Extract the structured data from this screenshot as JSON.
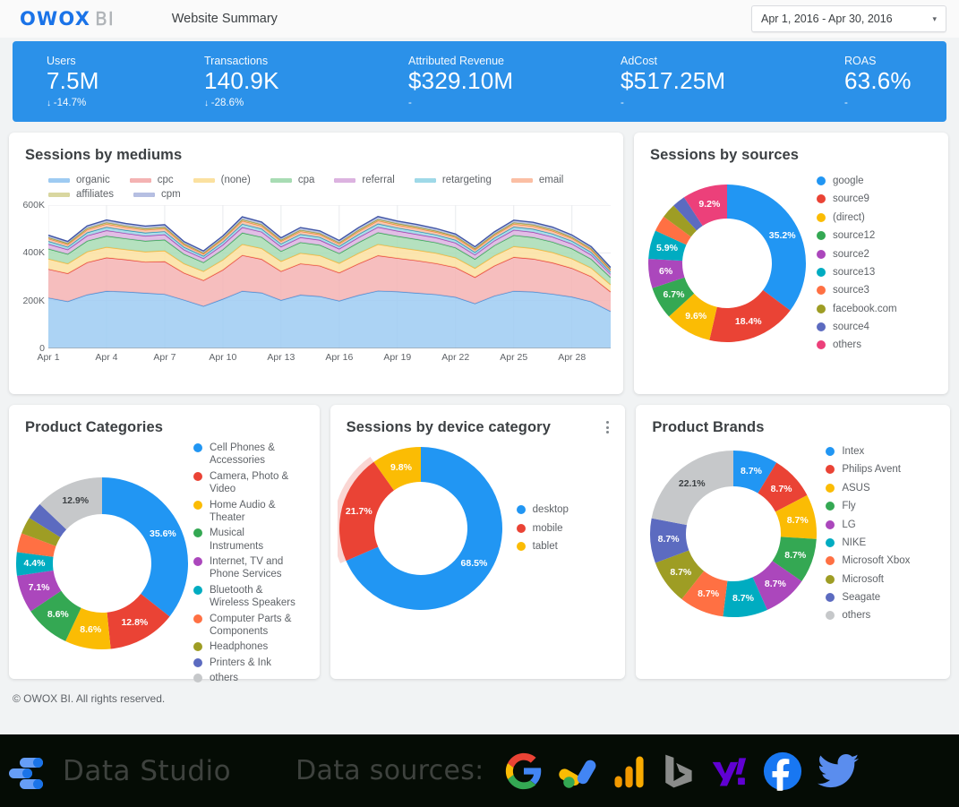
{
  "header": {
    "logo_primary": "OWOX",
    "logo_secondary": "BI",
    "report_title": "Website Summary",
    "date_range": "Apr 1, 2016 - Apr 30, 2016",
    "caret": "▾"
  },
  "scorecards": [
    {
      "label": "Users",
      "value": "7.5M",
      "delta": "-14.7%",
      "arrow": "↓"
    },
    {
      "label": "Transactions",
      "value": "140.9K",
      "delta": "-28.6%",
      "arrow": "↓"
    },
    {
      "label": "Attributed Revenue",
      "value": "$329.10M",
      "delta": "-",
      "arrow": ""
    },
    {
      "label": "AdCost",
      "value": "$517.25M",
      "delta": "-",
      "arrow": ""
    },
    {
      "label": "ROAS",
      "value": "63.6%",
      "delta": "-",
      "arrow": ""
    }
  ],
  "cards": {
    "mediums": {
      "title": "Sessions by mediums"
    },
    "sources": {
      "title": "Sessions by sources"
    },
    "categories": {
      "title": "Product Categories"
    },
    "devices": {
      "title": "Sessions by device category",
      "menu_icon": "kebab-menu-icon"
    },
    "brands": {
      "title": "Product Brands"
    }
  },
  "footer": {
    "copyright": "© OWOX BI. All rights reserved.",
    "data_studio_brand": "Data Studio",
    "data_sources_label": "Data sources:",
    "source_icons": [
      "google-icon",
      "google-ads-icon",
      "google-analytics-icon",
      "bing-icon",
      "yahoo-icon",
      "facebook-icon",
      "twitter-icon"
    ]
  },
  "chart_data": [
    {
      "id": "mediums",
      "type": "area",
      "title": "Sessions by mediums",
      "stacked": true,
      "xlabel": "",
      "ylabel": "",
      "ylim": [
        0,
        600000
      ],
      "yticks": [
        "0",
        "200K",
        "400K",
        "600K"
      ],
      "ytick_values": [
        0,
        200000,
        400000,
        600000
      ],
      "grid": true,
      "legend_position": "top",
      "x": [
        "Apr 1",
        "Apr 2",
        "Apr 3",
        "Apr 4",
        "Apr 5",
        "Apr 6",
        "Apr 7",
        "Apr 8",
        "Apr 9",
        "Apr 10",
        "Apr 11",
        "Apr 12",
        "Apr 13",
        "Apr 14",
        "Apr 15",
        "Apr 16",
        "Apr 17",
        "Apr 18",
        "Apr 19",
        "Apr 20",
        "Apr 21",
        "Apr 22",
        "Apr 23",
        "Apr 24",
        "Apr 25",
        "Apr 26",
        "Apr 27",
        "Apr 28",
        "Apr 29",
        "Apr 30"
      ],
      "xticks": [
        "Apr 1",
        "Apr 4",
        "Apr 7",
        "Apr 10",
        "Apr 13",
        "Apr 16",
        "Apr 19",
        "Apr 22",
        "Apr 25",
        "Apr 28"
      ],
      "series": [
        {
          "name": "organic",
          "color": "#9ecbf2",
          "line": "#4a90d9",
          "values": [
            212000,
            197000,
            225000,
            240000,
            237000,
            232000,
            227000,
            203000,
            177000,
            207000,
            240000,
            233000,
            202000,
            224000,
            218000,
            199000,
            223000,
            241000,
            238000,
            232000,
            226000,
            215000,
            188000,
            220000,
            240000,
            237000,
            228000,
            216000,
            196000,
            155000
          ]
        },
        {
          "name": "cpc",
          "color": "#f4b3b3",
          "line": "#e8453c",
          "values": [
            120000,
            117000,
            135000,
            140000,
            135000,
            130000,
            137000,
            113000,
            108000,
            122000,
            150000,
            141000,
            121000,
            131000,
            128000,
            118000,
            132000,
            148000,
            140000,
            136000,
            130000,
            124000,
            110000,
            126000,
            142000,
            138000,
            131000,
            120000,
            105000,
            82000
          ]
        },
        {
          "name": "(none)",
          "color": "#fbe1a0",
          "line": "#f9b63a",
          "values": [
            43000,
            41000,
            45000,
            44000,
            42000,
            43000,
            45000,
            39000,
            38000,
            42000,
            46000,
            45000,
            42000,
            44000,
            43000,
            40000,
            44000,
            47000,
            45000,
            44000,
            43000,
            41000,
            38000,
            42000,
            45000,
            44000,
            43000,
            40000,
            36000,
            30000
          ]
        },
        {
          "name": "cpa",
          "color": "#a8dcb4",
          "line": "#34a853",
          "values": [
            42000,
            40000,
            45000,
            47000,
            46000,
            45000,
            46000,
            40000,
            37000,
            43000,
            48000,
            47000,
            42000,
            45000,
            44000,
            41000,
            45000,
            49000,
            47000,
            45000,
            44000,
            42000,
            38000,
            43000,
            47000,
            46000,
            44000,
            42000,
            37000,
            30000
          ]
        },
        {
          "name": "referral",
          "color": "#dcb3e0",
          "line": "#a73fb0",
          "values": [
            20000,
            19000,
            22000,
            23000,
            22000,
            21000,
            22000,
            18000,
            17000,
            20000,
            23000,
            22000,
            19000,
            21000,
            21000,
            19000,
            21000,
            23000,
            22000,
            21000,
            21000,
            20000,
            18000,
            20000,
            22000,
            22000,
            21000,
            20000,
            18000,
            14000
          ]
        },
        {
          "name": "retargeting",
          "color": "#9fd9e8",
          "line": "#2196bb",
          "values": [
            12000,
            11000,
            13000,
            14000,
            13000,
            13000,
            13000,
            11000,
            10000,
            12000,
            14000,
            13000,
            12000,
            13000,
            12000,
            11000,
            13000,
            14000,
            13000,
            13000,
            12000,
            12000,
            11000,
            12000,
            13000,
            13000,
            13000,
            12000,
            11000,
            9000
          ]
        },
        {
          "name": "email",
          "color": "#fbbfa4",
          "line": "#f4813c",
          "values": [
            11000,
            10000,
            12000,
            13000,
            12000,
            12000,
            12000,
            10000,
            9000,
            11000,
            13000,
            12000,
            11000,
            12000,
            11000,
            10000,
            12000,
            13000,
            12000,
            12000,
            11000,
            11000,
            10000,
            11000,
            12000,
            12000,
            12000,
            11000,
            10000,
            8000
          ]
        },
        {
          "name": "affiliates",
          "color": "#d9d7a0",
          "line": "#9c9a30",
          "values": [
            5000,
            5000,
            6000,
            6000,
            6000,
            6000,
            6000,
            5000,
            4000,
            5000,
            6000,
            6000,
            5000,
            6000,
            5000,
            5000,
            6000,
            6000,
            6000,
            6000,
            5000,
            5000,
            5000,
            5000,
            6000,
            6000,
            6000,
            5000,
            5000,
            4000
          ]
        },
        {
          "name": "cpm",
          "color": "#b6bfe2",
          "line": "#4156a6",
          "values": [
            9000,
            8000,
            10000,
            11000,
            10000,
            10000,
            10000,
            8000,
            8000,
            9000,
            11000,
            10000,
            9000,
            10000,
            10000,
            9000,
            10000,
            11000,
            10000,
            10000,
            10000,
            9000,
            8000,
            9000,
            10000,
            10000,
            10000,
            9000,
            8000,
            7000
          ]
        }
      ]
    },
    {
      "id": "sources",
      "type": "pie",
      "title": "Sessions by sources",
      "donut": true,
      "legend_position": "right",
      "labels": [
        "google",
        "source9",
        "(direct)",
        "source12",
        "source2",
        "source13",
        "source3",
        "facebook.com",
        "source4",
        "others"
      ],
      "values": [
        35.2,
        18.4,
        9.6,
        6.7,
        6.0,
        5.9,
        3.3,
        3.0,
        2.7,
        9.2
      ],
      "displayed_labels": [
        "35.2%",
        "18.4%",
        "9.6%",
        "6.7%",
        "6%",
        "5.9%",
        "",
        "",
        "",
        "9.2%"
      ],
      "colors": [
        "#2196f3",
        "#ea4335",
        "#fbbc04",
        "#34a853",
        "#ab47bc",
        "#00acc1",
        "#ff7043",
        "#9e9d24",
        "#5c6bc0",
        "#ec407a"
      ]
    },
    {
      "id": "categories",
      "type": "pie",
      "title": "Product Categories",
      "donut": true,
      "legend_position": "right",
      "labels": [
        "Cell Phones & Accessories",
        "Camera, Photo & Video",
        "Home Audio & Theater",
        "Musical Instruments",
        "Internet, TV and Phone Services",
        "Bluetooth & Wireless Speakers",
        "Computer Parts & Components",
        "Headphones",
        "Printers & Ink",
        "others"
      ],
      "values": [
        35.6,
        12.8,
        8.6,
        8.6,
        7.1,
        4.4,
        3.6,
        3.2,
        3.2,
        12.9
      ],
      "displayed_labels": [
        "35.6%",
        "12.8%",
        "8.6%",
        "8.6%",
        "7.1%",
        "4.4%",
        "",
        "",
        "",
        "12.9%"
      ],
      "colors": [
        "#2196f3",
        "#ea4335",
        "#fbbc04",
        "#34a853",
        "#ab47bc",
        "#00acc1",
        "#ff7043",
        "#9e9d24",
        "#5c6bc0",
        "#c6c8ca"
      ]
    },
    {
      "id": "devices",
      "type": "pie",
      "title": "Sessions by device category",
      "donut": true,
      "legend_position": "right",
      "labels": [
        "desktop",
        "mobile",
        "tablet"
      ],
      "values": [
        68.5,
        21.7,
        9.8
      ],
      "displayed_labels": [
        "68.5%",
        "21.7%",
        "9.8%"
      ],
      "colors": [
        "#2196f3",
        "#ea4335",
        "#fbbc04"
      ],
      "highlighted": "mobile"
    },
    {
      "id": "brands",
      "type": "pie",
      "title": "Product Brands",
      "donut": true,
      "legend_position": "right",
      "labels": [
        "Intex",
        "Philips Avent",
        "ASUS",
        "Fly",
        "LG",
        "NIKE",
        "Microsoft Xbox",
        "Microsoft",
        "Seagate",
        "others"
      ],
      "values": [
        8.7,
        8.7,
        8.7,
        8.7,
        8.7,
        8.7,
        8.7,
        8.7,
        8.7,
        22.1
      ],
      "displayed_labels": [
        "8.7%",
        "8.7%",
        "8.7%",
        "8.7%",
        "8.7%",
        "8.7%",
        "8.7%",
        "8.7%",
        "8.7%",
        "22.1%"
      ],
      "colors": [
        "#2196f3",
        "#ea4335",
        "#fbbc04",
        "#34a853",
        "#ab47bc",
        "#00acc1",
        "#ff7043",
        "#9e9d24",
        "#5c6bc0",
        "#c6c8ca"
      ]
    }
  ]
}
